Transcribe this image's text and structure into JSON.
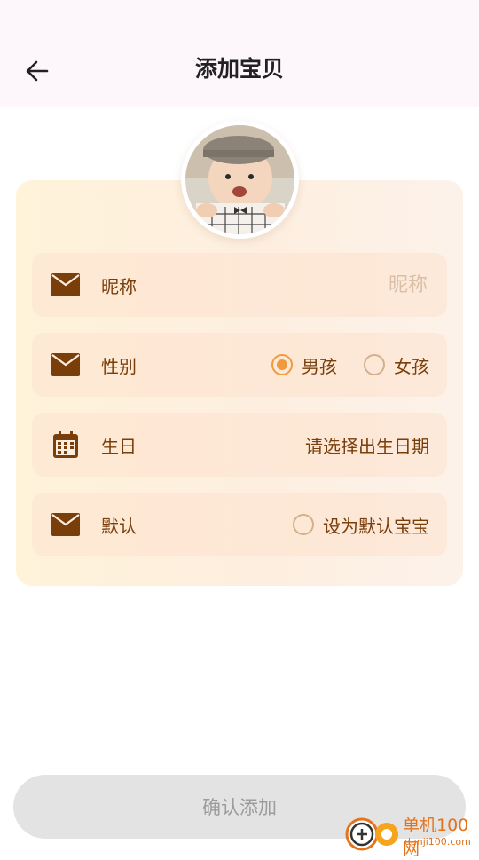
{
  "header": {
    "title": "添加宝贝",
    "back_icon": "arrow-left-icon"
  },
  "avatar": {
    "description": "baby photo"
  },
  "form": {
    "nickname": {
      "label": "昵称",
      "placeholder": "昵称",
      "value": "",
      "icon": "mail-icon"
    },
    "gender": {
      "label": "性别",
      "icon": "mail-icon",
      "options": [
        "男孩",
        "女孩"
      ],
      "selected": "男孩"
    },
    "birthday": {
      "label": "生日",
      "icon": "calendar-icon",
      "placeholder": "请选择出生日期"
    },
    "default": {
      "label": "默认",
      "icon": "mail-icon",
      "option": "设为默认宝宝",
      "checked": false
    }
  },
  "confirm_label": "确认添加",
  "watermark": {
    "name": "单机100网",
    "url": "danji100.com"
  },
  "colors": {
    "accent": "#f09a3e",
    "icon": "#7a3e0b",
    "button_bg": "#e3e3e3",
    "button_text": "#9c9c9c"
  }
}
